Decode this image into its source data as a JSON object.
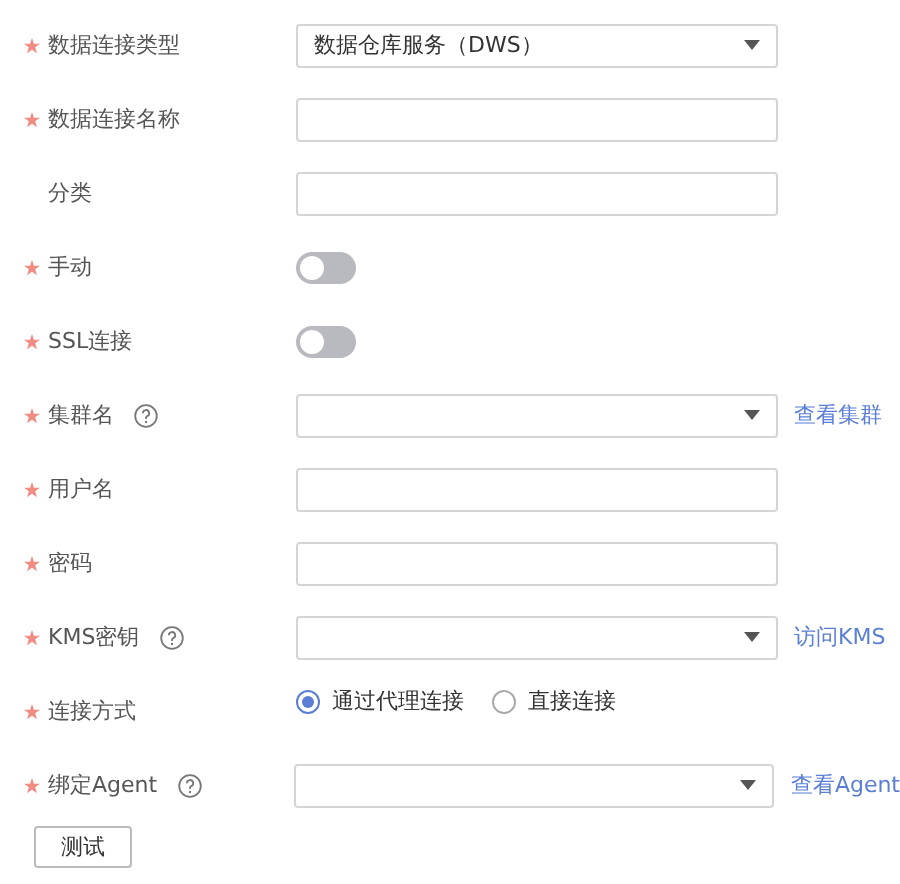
{
  "fields": [
    {
      "kind": "select",
      "label": "数据连接类型",
      "required": true,
      "help": false,
      "value": "数据仓库服务（DWS）"
    },
    {
      "kind": "text",
      "label": "数据连接名称",
      "required": true,
      "help": false
    },
    {
      "kind": "text",
      "label": "分类",
      "required": false,
      "help": false
    },
    {
      "kind": "toggle",
      "label": "手动",
      "required": true,
      "help": false,
      "on": false
    },
    {
      "kind": "toggle",
      "label": "SSL连接",
      "required": true,
      "help": false,
      "on": false
    },
    {
      "kind": "select",
      "label": "集群名",
      "required": true,
      "help": true,
      "link": "查看集群"
    },
    {
      "kind": "text",
      "label": "用户名",
      "required": true,
      "help": false
    },
    {
      "kind": "text",
      "label": "密码",
      "required": true,
      "help": false
    },
    {
      "kind": "select",
      "label": "KMS密钥",
      "required": true,
      "help": true,
      "link": "访问KMS"
    },
    {
      "kind": "radio",
      "label": "连接方式",
      "required": true,
      "help": false,
      "options": [
        {
          "label": "通过代理连接",
          "selected": true
        },
        {
          "label": "直接连接",
          "selected": false
        }
      ]
    },
    {
      "kind": "select",
      "label": "绑定Agent",
      "required": true,
      "help": true,
      "link": "查看Agent"
    }
  ],
  "button": "测试"
}
